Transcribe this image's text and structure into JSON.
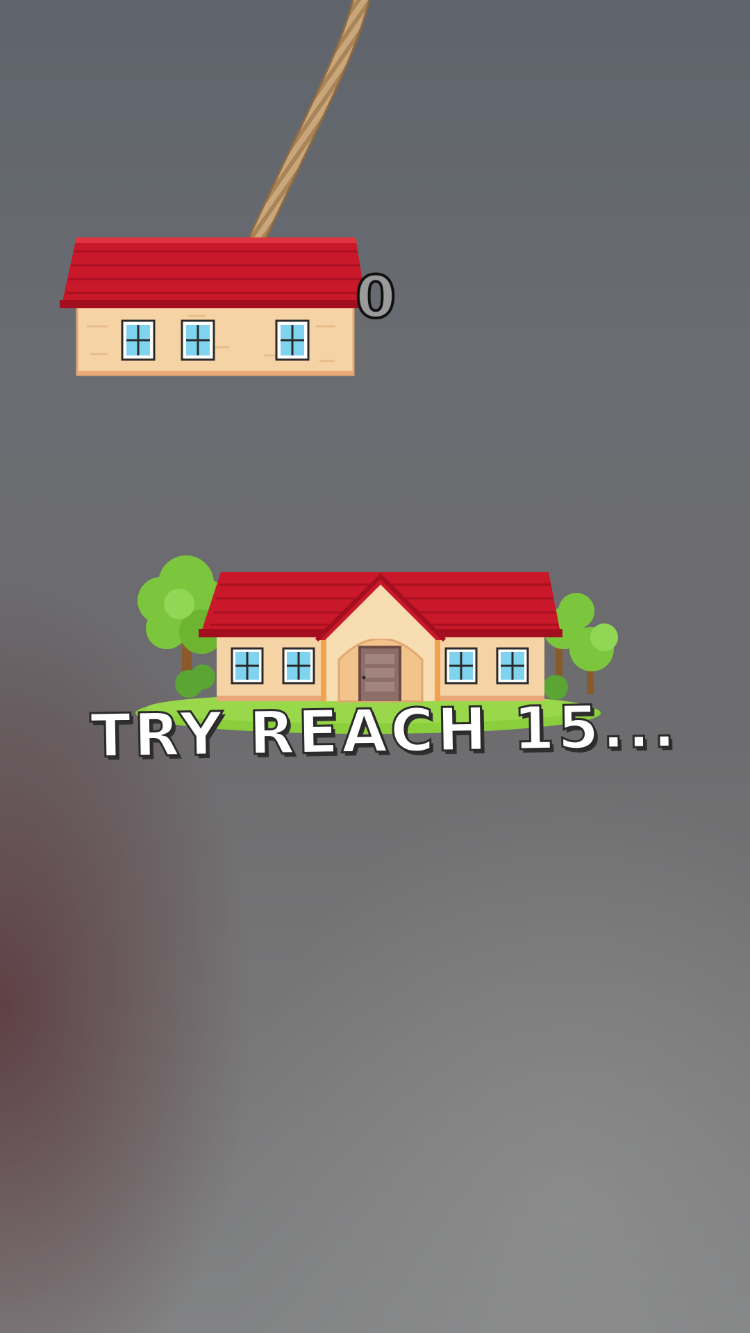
{
  "game": {
    "score": "0",
    "goal_text": "TRY REACH 15..."
  },
  "colors": {
    "roof_red": "#c8182a",
    "wall_peach": "#f6d3a4",
    "window_blue": "#7fd3ef",
    "grass_green": "#8ccf3c",
    "tree_green": "#7cc63e",
    "rope_tan": "#c9a77a",
    "door_brown": "#8e6e68"
  },
  "icons": {
    "hanging_block": "house-block-icon",
    "base_building": "house-base-icon",
    "rope": "rope-icon"
  }
}
